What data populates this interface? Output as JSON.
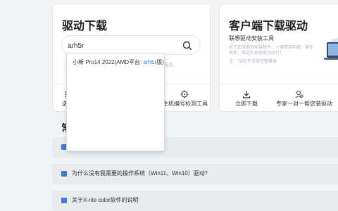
{
  "driver": {
    "title": "驱动下载",
    "search_value": "arh5r",
    "hint": "服务",
    "tools": [
      {
        "label": "选择",
        "icon": "list-icon"
      },
      {
        "label": "主机编号检测工具",
        "icon": "crosshair-icon"
      }
    ],
    "suggestion": {
      "prefix": "小新 Pro14 2022(AMD平台: ",
      "highlight": "arh5r",
      "suffix": "版)"
    }
  },
  "client": {
    "title": "客户端下载驱动",
    "subtitle": "联想驱动安装工具",
    "desc1": "官方正版驱动安装软件，一键精准匹配，操作简单，稳定的系统驱动运行！",
    "desc2": "注：“该软件支持完整兼容",
    "tools": [
      {
        "label": "立即下载",
        "icon": "download-icon"
      },
      {
        "label": "专家一对一帮您装驱动",
        "icon": "expert-icon"
      }
    ]
  },
  "faq": {
    "section_title": "常",
    "items": [
      {
        "text": ""
      },
      {
        "text": "为什么没有我需要的操作系统（Win11、Win10）驱动？"
      },
      {
        "text": "关于X-rite color软件的说明"
      }
    ]
  },
  "colors": {
    "accent": "#2b7de9",
    "faq_icon": "#3d7bd9"
  }
}
